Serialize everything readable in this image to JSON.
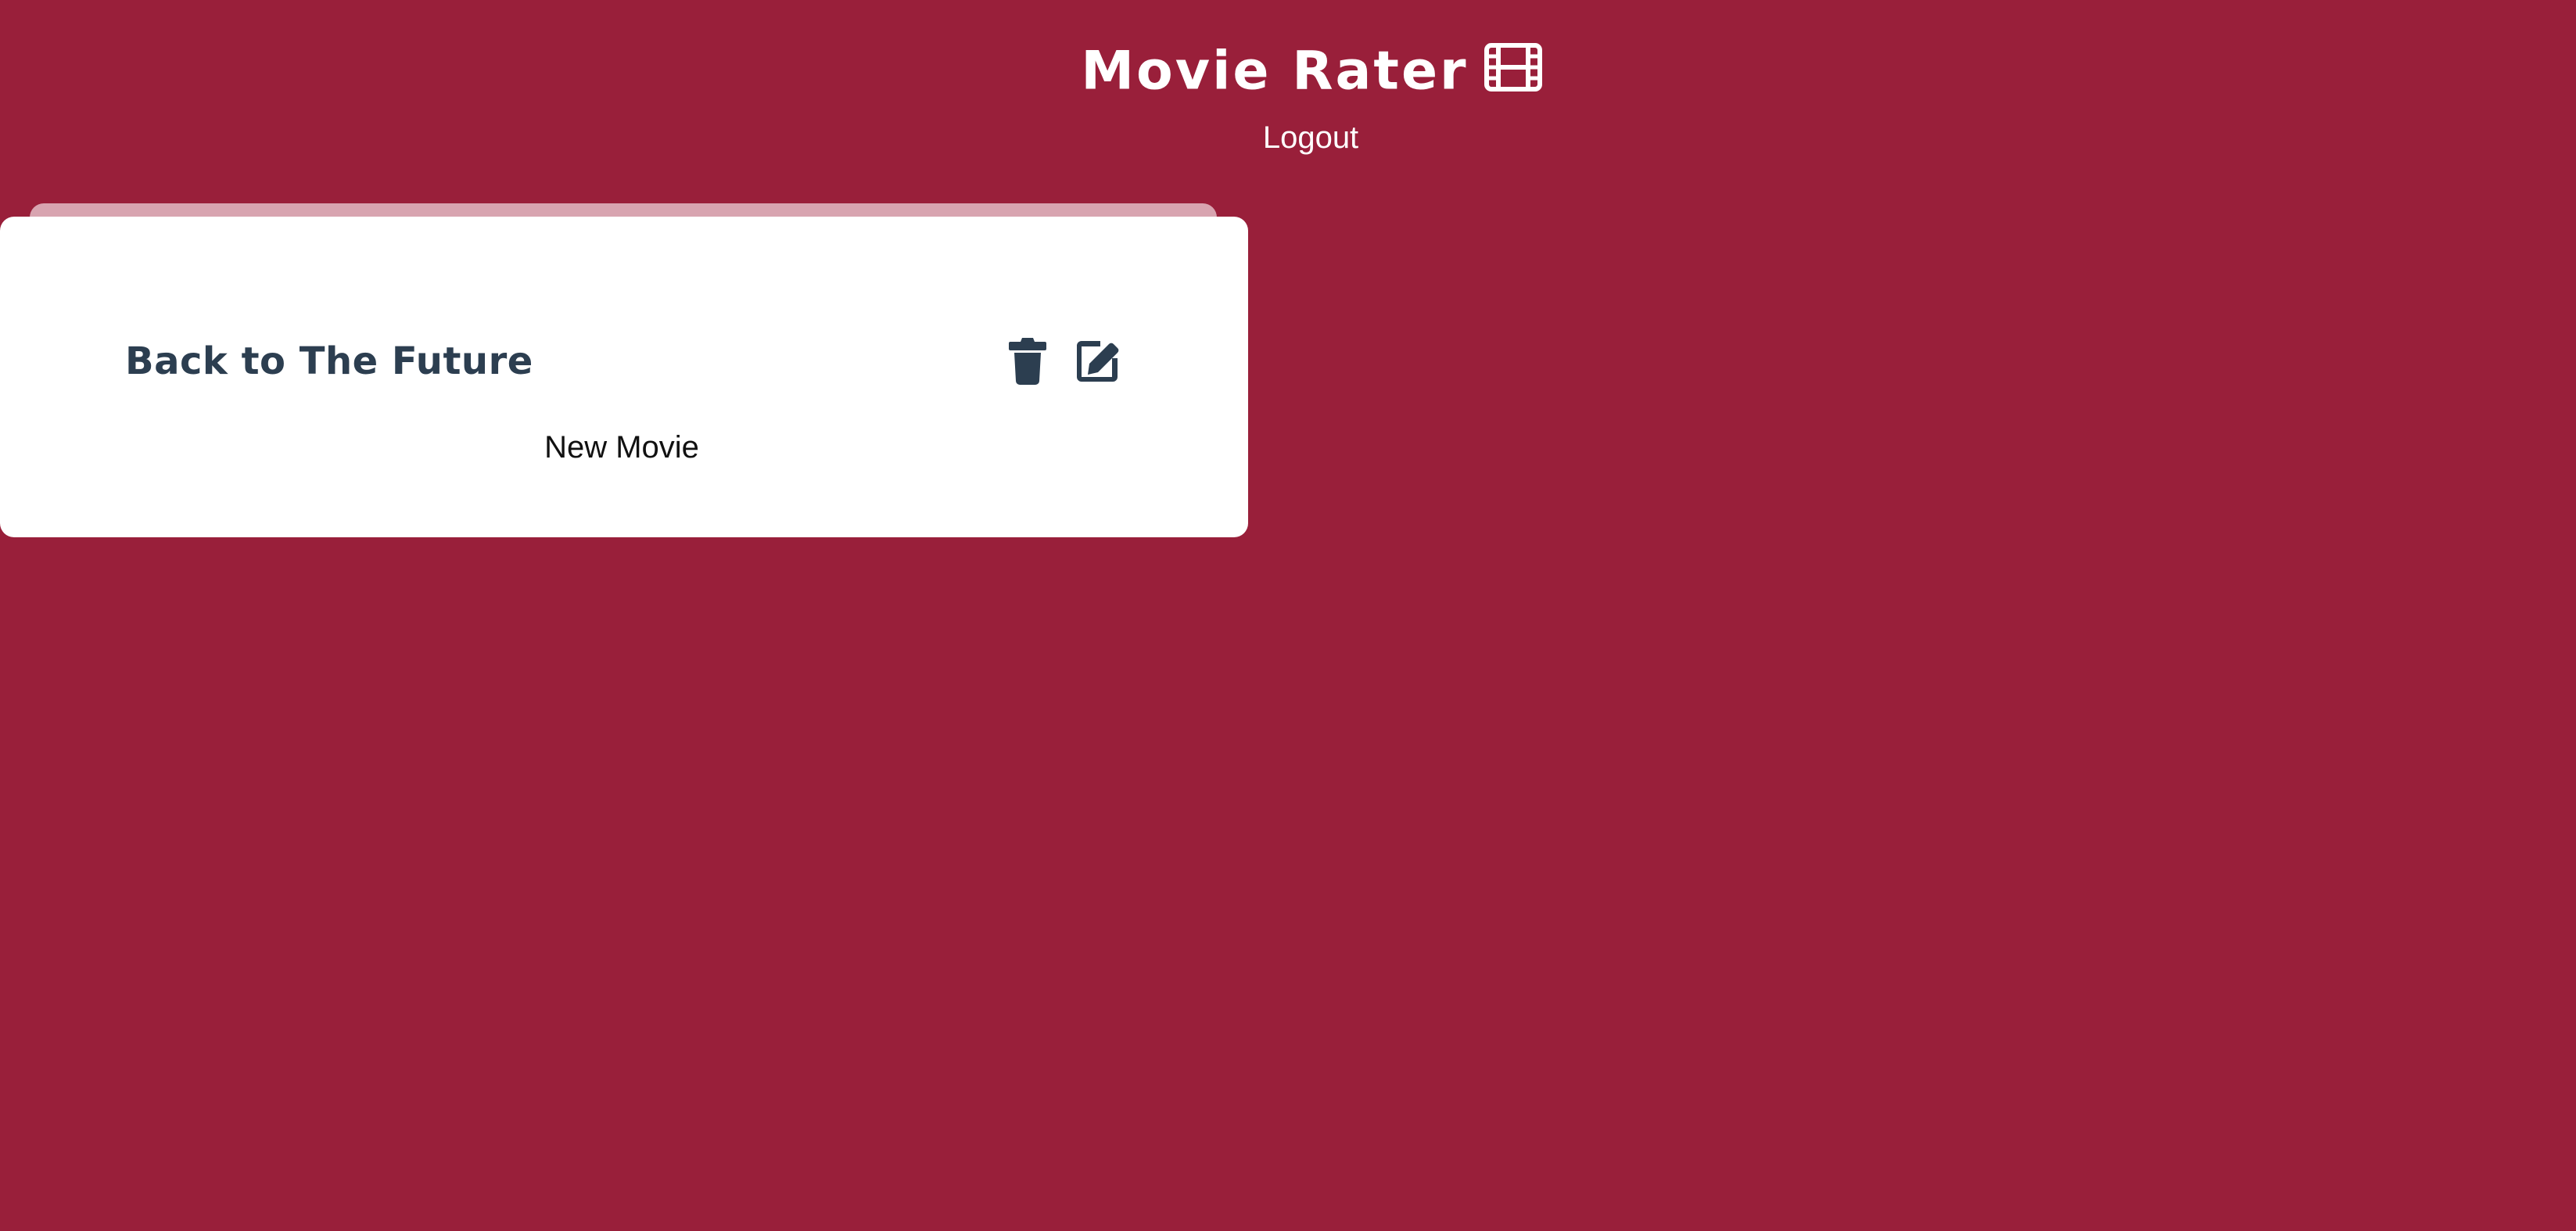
{
  "header": {
    "title": "Movie Rater",
    "title_icon": "film-icon",
    "logout_label": "Logout"
  },
  "movie_list": {
    "items": [
      {
        "title": "Back to The Future",
        "actions": [
          {
            "label": "delete",
            "icon": "trash-icon"
          },
          {
            "label": "edit",
            "icon": "edit-icon"
          }
        ]
      }
    ],
    "new_movie_label": "New Movie"
  },
  "colors": {
    "background": "#991f3a",
    "card": "#ffffff",
    "card_back": "#d8a4b0",
    "primary_text": "#2c3e50",
    "button_text": "#111111"
  }
}
